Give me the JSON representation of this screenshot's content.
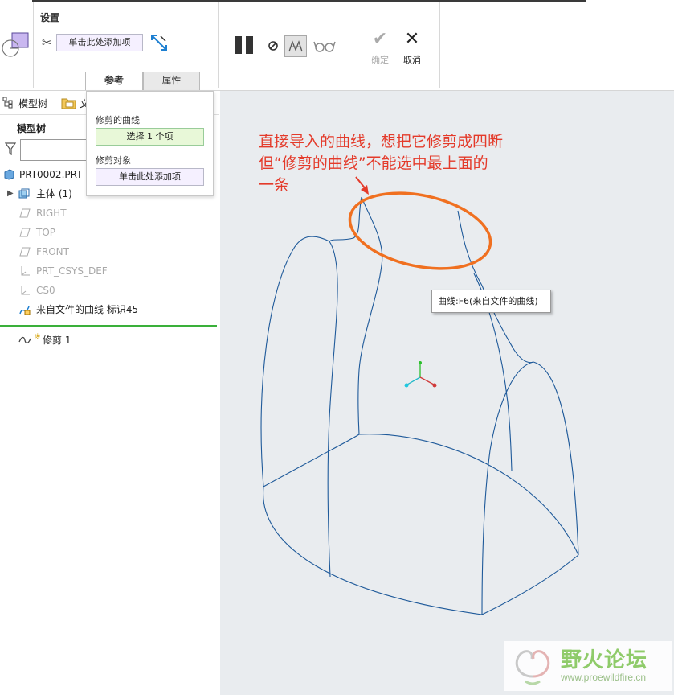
{
  "ribbon": {
    "group_title": "设置",
    "collector_placeholder": "单击此处添加项",
    "tabs": [
      {
        "label": "参考"
      },
      {
        "label": "属性"
      }
    ],
    "ok_label": "确定",
    "cancel_label": "取消"
  },
  "reference_panel": {
    "trim_curve_label": "修剪的曲线",
    "trim_curve_value": "选择 1 个项",
    "trim_object_label": "修剪对象",
    "trim_object_value": "单击此处添加项"
  },
  "left_panel": {
    "tab_model_tree": "模型树",
    "tab_files_partial": "文",
    "heading": "模型树",
    "items": [
      {
        "label": "PRT0002.PRT",
        "icon": "part-icon"
      },
      {
        "label": "主体 (1)",
        "icon": "body-icon"
      },
      {
        "label": "RIGHT",
        "icon": "datum-plane-icon"
      },
      {
        "label": "TOP",
        "icon": "datum-plane-icon"
      },
      {
        "label": "FRONT",
        "icon": "datum-plane-icon"
      },
      {
        "label": "PRT_CSYS_DEF",
        "icon": "csys-icon"
      },
      {
        "label": "CS0",
        "icon": "csys-icon"
      },
      {
        "label": "来自文件的曲线 标识45",
        "icon": "imported-curve-icon"
      },
      {
        "label": "修剪 1",
        "icon": "trim-feature-icon",
        "marker": "※"
      }
    ]
  },
  "viewport": {
    "annotation_lines": [
      "直接导入的曲线，想把它修剪成四断",
      "但“修剪的曲线”不能选中最上面的",
      "一条"
    ],
    "tooltip": "曲线:F6(来自文件的曲线)",
    "annotation_color": "#e43a2a",
    "highlight_color": "#f07020",
    "curve_color": "#1f5a9a"
  },
  "watermark": {
    "name": "野火论坛",
    "url": "www.proewildfire.cn"
  }
}
